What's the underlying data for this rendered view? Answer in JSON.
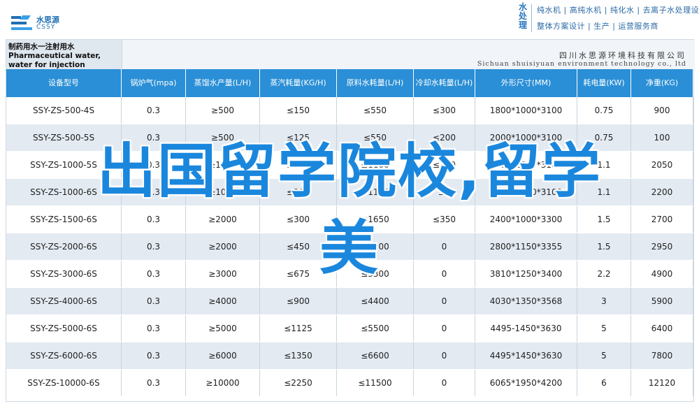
{
  "header": {
    "logo_cn": "水思源",
    "logo_en": "CSSY",
    "vertical_text": "水处理",
    "line1": "纯水机 | 高纯水机 | 纯化水 | 去离子水处理设备",
    "line2": "整体方案设计 | 生产 | 运营服务商"
  },
  "document": {
    "title": "制药用水一注射用水 Pharmaceutical water, water for injection",
    "company_cn": "四川水思源环境科技有限公司",
    "company_en": "Sichuan shuisiyuan environment technology co., ltd"
  },
  "table": {
    "columns": [
      "设备型号",
      "锅炉气(mpa)",
      "蒸馏水产量(L/H)",
      "蒸汽耗量(KG/H)",
      "原料水耗量(L/H)",
      "冷却水耗量(L/H)",
      "外形尺寸(MM)",
      "耗电量(KW)",
      "净重(KG)"
    ],
    "rows": [
      [
        "SSY-ZS-500-4S",
        "0.3",
        "≥500",
        "≤150",
        "≤550",
        "≤300",
        "1800*1000*3100",
        "0.75",
        "900"
      ],
      [
        "SSY-ZS-500-5S",
        "0.3",
        "≥500",
        "≤125",
        "≤550",
        "≤200",
        "2000*1000*3100",
        "0.75",
        "100"
      ],
      [
        "SSY-ZS-1000-5S",
        "0.3",
        "≥1000",
        "≤250",
        "≤1100",
        "≤300",
        "2000*1000*3100",
        "1.1",
        "2050"
      ],
      [
        "SSY-ZS-1000-6S",
        "0.3",
        "≥1000",
        "≤200",
        "≤1100",
        "≤0",
        "2200*1000*3100",
        "1.1",
        "2200"
      ],
      [
        "SSY-ZS-1500-6S",
        "0.3",
        "≥2000",
        "≤300",
        "≤1650",
        "≤350",
        "2400*1000*3300",
        "1.5",
        "2700"
      ],
      [
        "SSY-ZS-2000-6S",
        "0.3",
        "≥2000",
        "≤450",
        "≤2200",
        "0",
        "2800*1150*3355",
        "1.5",
        "2950"
      ],
      [
        "SSY-ZS-3000-6S",
        "0.3",
        "≥3000",
        "≤675",
        "≤3300",
        "0",
        "3810*1250*3400",
        "2.2",
        "4900"
      ],
      [
        "SSY-ZS-4000-6S",
        "0.3",
        "≥4000",
        "≤900",
        "≤4400",
        "0",
        "4030*1350*3568",
        "3",
        "5900"
      ],
      [
        "SSY-ZS-5000-6S",
        "0.3",
        "≥5000",
        "≤1125",
        "≤5500",
        "0",
        "4495-1450*3630",
        "5",
        "6400"
      ],
      [
        "SSY-ZS-6000-6S",
        "0.3",
        "≥6000",
        "≤1350",
        "≤6600",
        "0",
        "4495*1450*3630",
        "5",
        "7800"
      ],
      [
        "SSY-ZS-10000-6S",
        "0.3",
        "≥10000",
        "≤2250",
        "≤11500",
        "0",
        "6065*1950*4200",
        "6",
        "12120"
      ]
    ]
  },
  "overlay": {
    "line1": "出国留学院校,留学",
    "line2": "美"
  },
  "colors": {
    "header_blue": "#2a8fd6",
    "row_alt": "#e3eaf2",
    "overlay_text": "#1a87dd"
  }
}
